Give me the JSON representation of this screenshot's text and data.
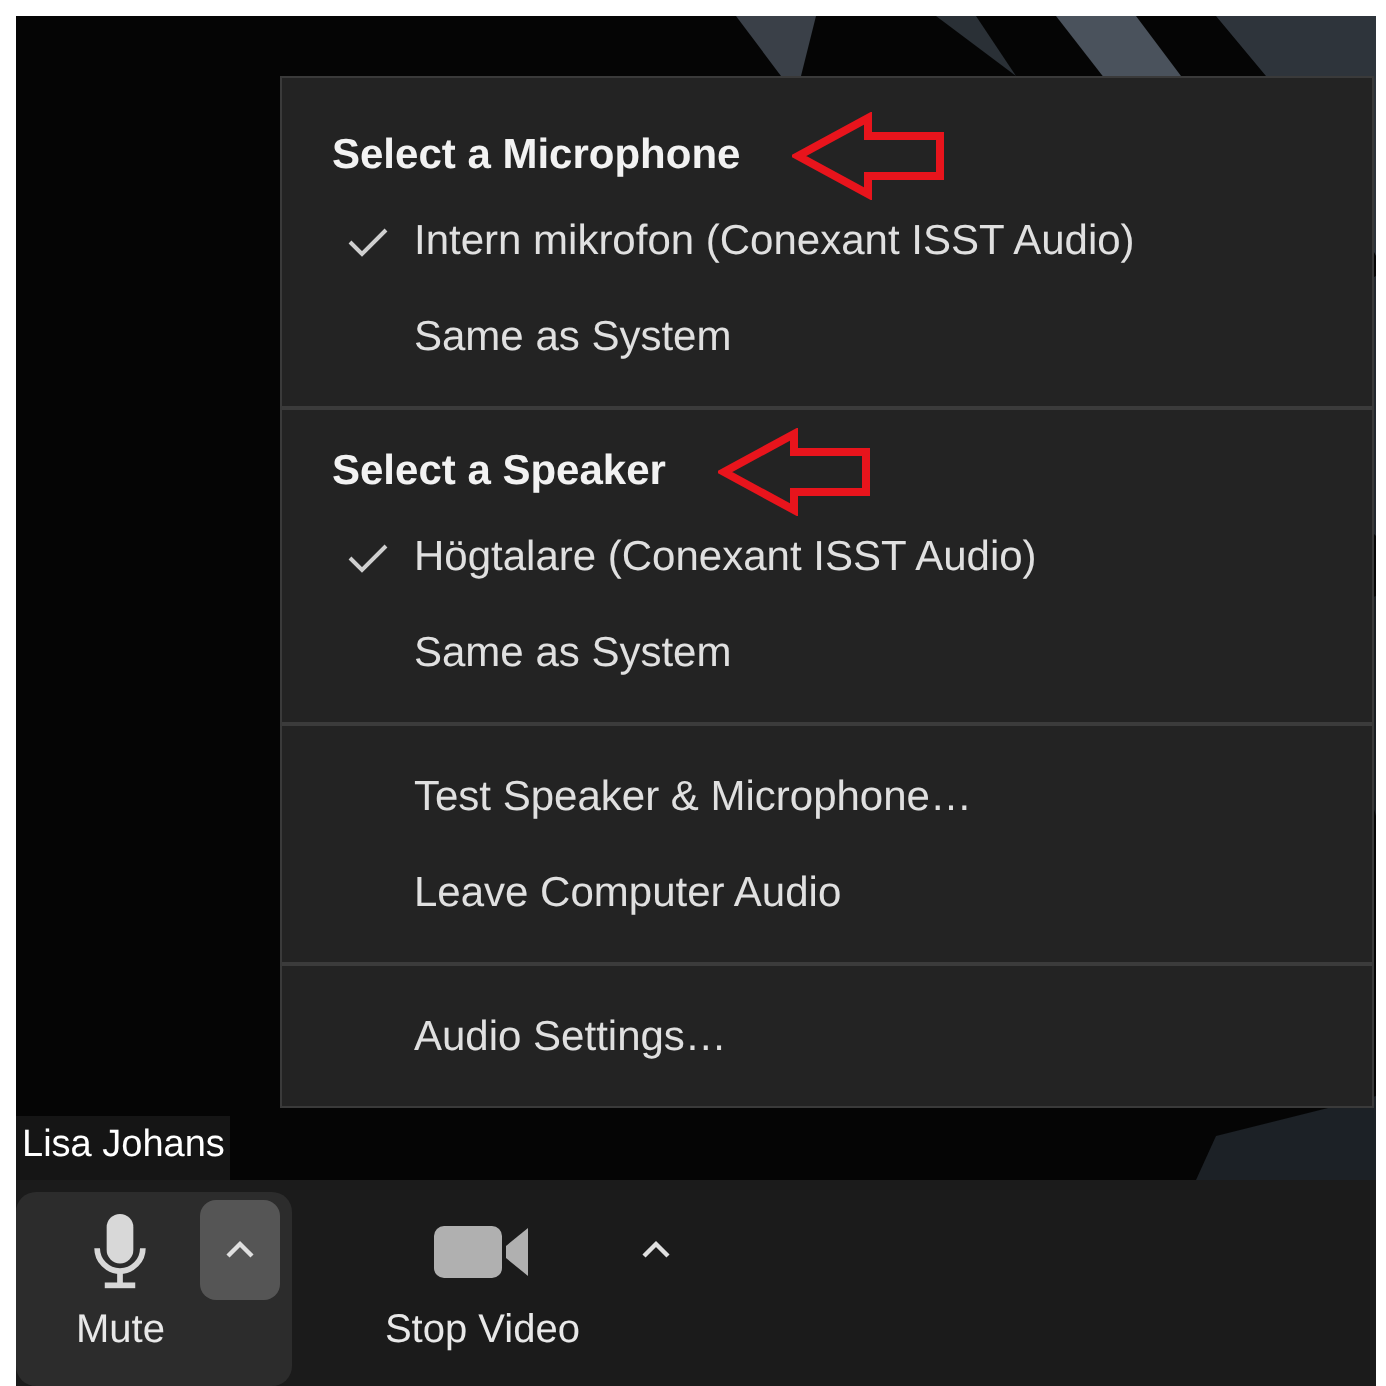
{
  "video": {
    "kind": "picture",
    "participant_name": "Lisa Johans"
  },
  "menu": {
    "sections": [
      {
        "heading": "Select a Microphone",
        "marked": true,
        "items": [
          {
            "label": "Intern mikrofon (Conexant ISST Audio)",
            "checked": true
          },
          {
            "label": "Same as System",
            "checked": false
          }
        ]
      },
      {
        "heading": "Select a Speaker",
        "marked": true,
        "items": [
          {
            "label": "Högtalare (Conexant ISST Audio)",
            "checked": true
          },
          {
            "label": "Same as System",
            "checked": false
          }
        ]
      },
      {
        "items": [
          {
            "label": "Test Speaker & Microphone…"
          },
          {
            "label": "Leave Computer Audio"
          }
        ]
      },
      {
        "items": [
          {
            "label": "Audio Settings…"
          }
        ]
      }
    ]
  },
  "toolbar": [
    {
      "kind": "mic",
      "label": "Mute",
      "active": true
    },
    {
      "kind": "video",
      "label": "Stop Video",
      "active": false
    }
  ]
}
